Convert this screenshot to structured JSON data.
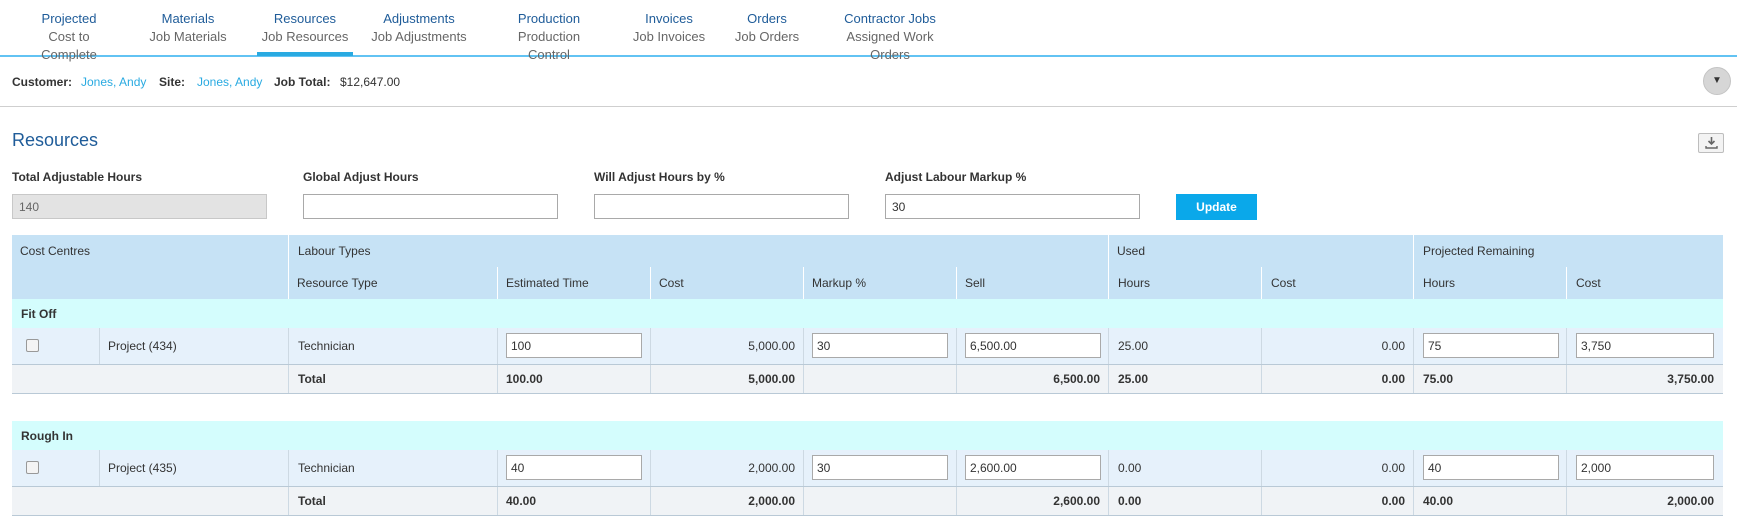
{
  "tabs": [
    {
      "top": "Projected",
      "bottom": "Cost to Complete"
    },
    {
      "top": "Materials",
      "bottom": "Job Materials"
    },
    {
      "top": "Resources",
      "bottom": "Job Resources"
    },
    {
      "top": "Adjustments",
      "bottom": "Job Adjustments"
    },
    {
      "top": "Production",
      "bottom": "Production Control"
    },
    {
      "top": "Invoices",
      "bottom": "Job Invoices"
    },
    {
      "top": "Orders",
      "bottom": "Job Orders"
    },
    {
      "top": "Contractor Jobs",
      "bottom": "Assigned Work Orders"
    }
  ],
  "customer_bar": {
    "customer_label": "Customer:",
    "customer_value": "Jones, Andy",
    "site_label": "Site:",
    "site_value": "Jones, Andy",
    "job_total_label": "Job Total:",
    "job_total_value": "$12,647.00"
  },
  "page_title": "Resources",
  "fields": {
    "total_adjustable_hours_label": "Total Adjustable Hours",
    "total_adjustable_hours_value": "140",
    "global_adjust_hours_label": "Global Adjust Hours",
    "global_adjust_hours_value": "",
    "adjust_hours_pct_label": "Will Adjust Hours by %",
    "adjust_hours_pct_value": "",
    "labour_markup_label": "Adjust Labour Markup %",
    "labour_markup_value": "30",
    "update_label": "Update"
  },
  "table": {
    "group_headers": {
      "cost_centres": "Cost Centres",
      "labour_types": "Labour Types",
      "used": "Used",
      "projected_remaining": "Projected Remaining"
    },
    "columns": {
      "resource_type": "Resource Type",
      "estimated_time": "Estimated Time",
      "cost": "Cost",
      "markup": "Markup %",
      "sell": "Sell",
      "used_hours": "Hours",
      "used_cost": "Cost",
      "rem_hours": "Hours",
      "rem_cost": "Cost"
    },
    "groups": [
      {
        "name": "Fit Off",
        "row": {
          "cost_centre": "Project (434)",
          "resource_type": "Technician",
          "estimated_time": "100",
          "cost": "5,000.00",
          "markup": "30",
          "sell": "6,500.00",
          "used_hours": "25.00",
          "used_cost": "0.00",
          "rem_hours": "75",
          "rem_cost": "3,750"
        },
        "total": {
          "label": "Total",
          "estimated_time": "100.00",
          "cost": "5,000.00",
          "sell": "6,500.00",
          "used_hours": "25.00",
          "used_cost": "0.00",
          "rem_hours": "75.00",
          "rem_cost": "3,750.00"
        }
      },
      {
        "name": "Rough In",
        "row": {
          "cost_centre": "Project (435)",
          "resource_type": "Technician",
          "estimated_time": "40",
          "cost": "2,000.00",
          "markup": "30",
          "sell": "2,600.00",
          "used_hours": "0.00",
          "used_cost": "0.00",
          "rem_hours": "40",
          "rem_cost": "2,000"
        },
        "total": {
          "label": "Total",
          "estimated_time": "40.00",
          "cost": "2,000.00",
          "sell": "2,600.00",
          "used_hours": "0.00",
          "used_cost": "0.00",
          "rem_hours": "40.00",
          "rem_cost": "2,000.00"
        }
      }
    ]
  },
  "icons": {
    "collapse": "chevron-down-icon",
    "export": "download-icon"
  },
  "colors": {
    "accent": "#29aae1",
    "title": "#1f5c99",
    "header_bg": "#c6e2f5",
    "group_bg": "#d4fdfd",
    "button": "#0aa8ea"
  }
}
